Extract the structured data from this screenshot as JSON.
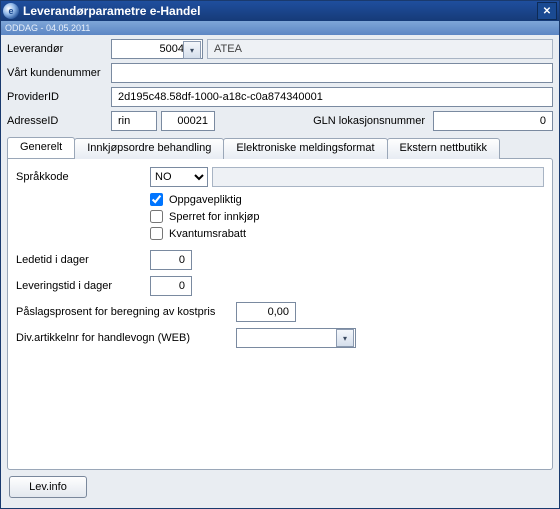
{
  "window": {
    "title": "Leverandørparametre e-Handel"
  },
  "subbar": "ODDAG - 04.05.2011",
  "labels": {
    "leverandor": "Leverandør",
    "vart_kundenr": "Vårt kundenummer",
    "providerid": "ProviderID",
    "adresseid": "AdresseID",
    "gln": "GLN lokasjonsnummer"
  },
  "fields": {
    "leverandor_id": "5004",
    "leverandor_name": "ATEA",
    "vart_kundenr": "",
    "providerid": "2d195c48.58df-1000-a18c-c0a874340001",
    "adresse_code": "rin",
    "adresse_nr": "00021",
    "gln": "0"
  },
  "tabs": [
    "Generelt",
    "Innkjøpsordre behandling",
    "Elektroniske meldingsformat",
    "Ekstern nettbutikk"
  ],
  "panel": {
    "sprakkode_label": "Språkkode",
    "sprakkode_value": "NO",
    "sprakkode_desc": "",
    "chk_oppgavepliktig": "Oppgavepliktig",
    "chk_sperret": "Sperret for innkjøp",
    "chk_kvantumsrabatt": "Kvantumsrabatt",
    "ledetid_label": "Ledetid i dager",
    "ledetid_value": "0",
    "leveringstid_label": "Leveringstid i dager",
    "leveringstid_value": "0",
    "paslag_label": "Påslagsprosent for beregning av kostpris",
    "paslag_value": "0,00",
    "divart_label": "Div.artikkelnr for handlevogn (WEB)",
    "divart_value": ""
  },
  "checks": {
    "oppgavepliktig": true,
    "sperret": false,
    "kvantumsrabatt": false
  },
  "footer": {
    "lev_info": "Lev.info"
  }
}
